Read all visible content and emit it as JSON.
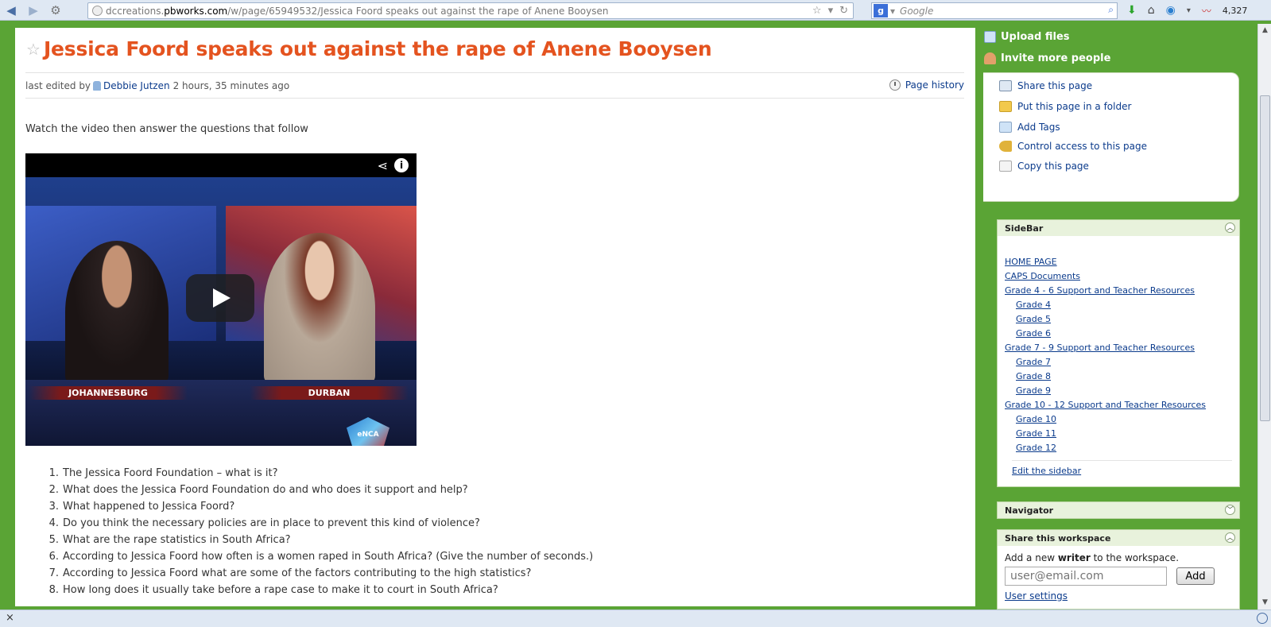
{
  "browser": {
    "url_prefix": "dccreations.",
    "url_domain": "pbworks.com",
    "url_rest": "/w/page/65949532/Jessica Foord speaks out against the rape of Anene Booysen",
    "search_placeholder": "Google",
    "search_engine_letter": "g",
    "counter": "4,327"
  },
  "page": {
    "title": "Jessica Foord speaks out against the rape of Anene Booysen",
    "last_edited_prefix": "last edited by",
    "editor": "Debbie Jutzen",
    "edited_ago": "2 hours, 35 minutes ago",
    "page_history": "Page history",
    "intro": "Watch the video then answer the questions that follow"
  },
  "video": {
    "location_left": "JOHANNESBURG",
    "location_right": "DURBAN",
    "logo_text": "eNCA"
  },
  "questions": [
    {
      "num": "1.",
      "text": "The Jessica Foord Foundation – what is it?"
    },
    {
      "num": "2.",
      "text": "What does the Jessica Foord Foundation do and who does it support and help?"
    },
    {
      "num": "3.",
      "text": "What happened to Jessica Foord?"
    },
    {
      "num": "4.",
      "text": "Do you think the necessary policies are in place to prevent this kind of violence?"
    },
    {
      "num": "5.",
      "text": "What are the rape statistics in South Africa?"
    },
    {
      "num": "6.",
      "text": "According to Jessica Foord how often is a women raped in South Africa? (Give the number of seconds.)"
    },
    {
      "num": "7.",
      "text": "According to Jessica Foord what are some of the factors contributing to the high statistics?"
    },
    {
      "num": "8.",
      "text": "How long does it usually take before a rape case to make it to court in South Africa?"
    }
  ],
  "right_panel": {
    "upload_files": "Upload files",
    "invite_people": "Invite more people",
    "actions": [
      "Share this page",
      "Put this page in a folder",
      "Add Tags",
      "Control access to this page",
      "Copy this page"
    ]
  },
  "sidebar": {
    "title": "SideBar",
    "links": [
      {
        "label": "HOME PAGE",
        "sub": false
      },
      {
        "label": "CAPS Documents",
        "sub": false
      },
      {
        "label": "Grade 4 - 6 Support and Teacher Resources",
        "sub": false
      },
      {
        "label": "Grade 4",
        "sub": true
      },
      {
        "label": "Grade 5",
        "sub": true
      },
      {
        "label": "Grade 6",
        "sub": true
      },
      {
        "label": "Grade 7 - 9 Support and Teacher Resources",
        "sub": false
      },
      {
        "label": "Grade 7",
        "sub": true
      },
      {
        "label": "Grade 8",
        "sub": true
      },
      {
        "label": "Grade 9",
        "sub": true
      },
      {
        "label": "Grade 10 - 12 Support and Teacher Resources",
        "sub": false
      },
      {
        "label": "Grade 10",
        "sub": true
      },
      {
        "label": "Grade 11",
        "sub": true
      },
      {
        "label": "Grade 12",
        "sub": true
      }
    ],
    "edit_link": "Edit the sidebar"
  },
  "navigator": {
    "title": "Navigator"
  },
  "share_workspace": {
    "title": "Share this workspace",
    "text_before": "Add a new ",
    "text_bold": "writer",
    "text_after": " to the workspace.",
    "email_placeholder": "user@email.com",
    "add_label": "Add",
    "user_settings": "User settings"
  },
  "statusbar": {
    "close": "×"
  }
}
